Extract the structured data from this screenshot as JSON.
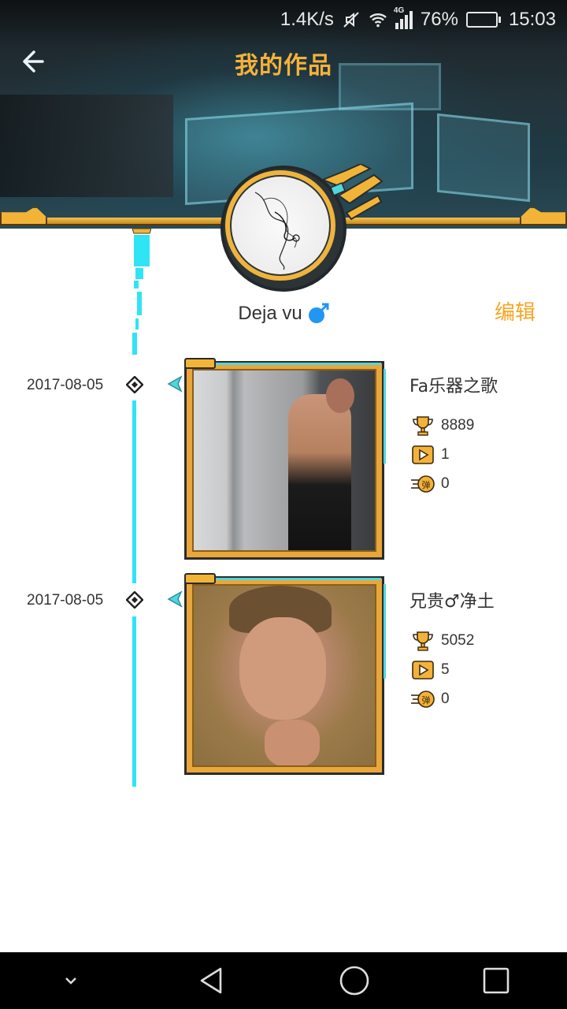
{
  "status_bar": {
    "speed": "1.4K/s",
    "network": "4G",
    "battery": "76%",
    "battery_level": 0.76,
    "time": "15:03",
    "icons": [
      "mute-icon",
      "wifi-icon",
      "signal-icon",
      "battery-icon"
    ]
  },
  "header": {
    "title": "我的作品",
    "back_icon": "back-arrow-icon"
  },
  "profile": {
    "username": "Deja vu",
    "gender": "male",
    "gender_icon": "male-icon",
    "edit_label": "编辑"
  },
  "works": [
    {
      "date": "2017-08-05",
      "title": "Fa乐器之歌",
      "trophy": "8889",
      "plays": "1",
      "danmaku": "0"
    },
    {
      "date": "2017-08-05",
      "title": "兄贵♂净土",
      "trophy": "5052",
      "plays": "5",
      "danmaku": "0"
    }
  ],
  "navbar": {
    "icons": [
      "collapse-icon",
      "back-triangle-icon",
      "home-circle-icon",
      "recents-square-icon"
    ]
  },
  "colors": {
    "accent_gold": "#f5b23a",
    "timeline_cyan": "#2fe4f5",
    "edit_orange": "#f5a623",
    "gender_blue": "#2196f3"
  }
}
